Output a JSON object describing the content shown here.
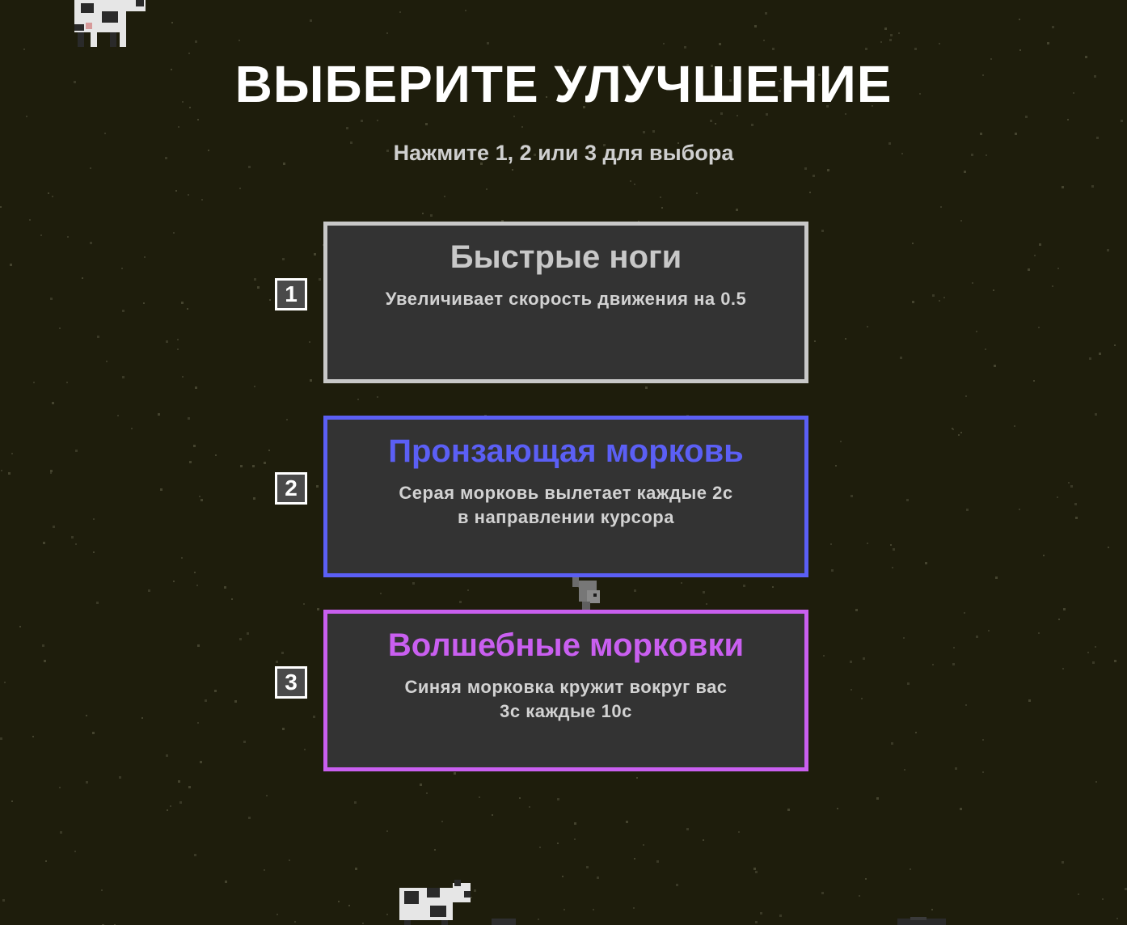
{
  "overlay": {
    "title": "ВЫБЕРИТЕ УЛУЧШЕНИЕ",
    "subtitle": "Нажмите 1, 2 или 3 для выбора"
  },
  "upgrades": [
    {
      "key": "1",
      "title": "Быстрые ноги",
      "description": [
        "Увеличивает скорость движения на 0.5"
      ],
      "rarity_color": "#c8c8c8"
    },
    {
      "key": "2",
      "title": "Пронзающая морковь",
      "description": [
        "Серая морковь вылетает каждые 2с",
        "в направлении курсора"
      ],
      "rarity_color": "#5b5ff5"
    },
    {
      "key": "3",
      "title": "Волшебные морковки",
      "description": [
        "Синяя морковка кружит вокруг вас",
        "3с каждые 10с"
      ],
      "rarity_color": "#c95ff0"
    }
  ],
  "colors": {
    "background": "#1e1d0c",
    "card_background": "#333333",
    "key_box": "#4a4a4a"
  },
  "sprites": [
    "cow-sprite",
    "cow-sprite",
    "rabbit-sprite",
    "cow-sprite"
  ]
}
